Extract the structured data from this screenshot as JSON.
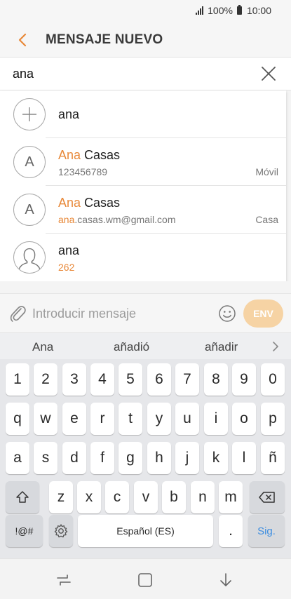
{
  "status_bar": {
    "battery": "100%",
    "time": "10:00"
  },
  "header": {
    "title": "MENSAJE NUEVO"
  },
  "recipient": {
    "value": "ana"
  },
  "suggestions": {
    "add": {
      "label": "ana"
    },
    "contacts": [
      {
        "avatar": "A",
        "name_match": "Ana",
        "name_rest": " Casas",
        "sub_match": "",
        "sub_rest": "123456789",
        "type": "Móvil"
      },
      {
        "avatar": "A",
        "name_match": "Ana",
        "name_rest": " Casas",
        "sub_match": "ana",
        "sub_rest": ".casas.wm@gmail.com",
        "type": "Casa"
      },
      {
        "avatar": "",
        "name_match": "",
        "name_rest": "ana",
        "sub_match": "",
        "sub_rest": "262",
        "type": ""
      }
    ]
  },
  "compose": {
    "placeholder": "Introducir mensaje",
    "send_label": "ENV"
  },
  "predictions": [
    "Ana",
    "añadió",
    "añadir"
  ],
  "keyboard": {
    "row_numbers": [
      "1",
      "2",
      "3",
      "4",
      "5",
      "6",
      "7",
      "8",
      "9",
      "0"
    ],
    "row_q": [
      "q",
      "w",
      "e",
      "r",
      "t",
      "y",
      "u",
      "i",
      "o",
      "p"
    ],
    "row_a": [
      "a",
      "s",
      "d",
      "f",
      "g",
      "h",
      "j",
      "k",
      "l",
      "ñ"
    ],
    "row_z": [
      "z",
      "x",
      "c",
      "v",
      "b",
      "n",
      "m"
    ],
    "symbols_label": "!@#",
    "space_label": "Español (ES)",
    "period_label": ".",
    "next_label": "Sig."
  },
  "colors": {
    "accent": "#e8893a",
    "send_disabled": "#f6d3a4",
    "keyboard_bg": "#e6e7ea",
    "next_key": "#3e8ee0"
  }
}
